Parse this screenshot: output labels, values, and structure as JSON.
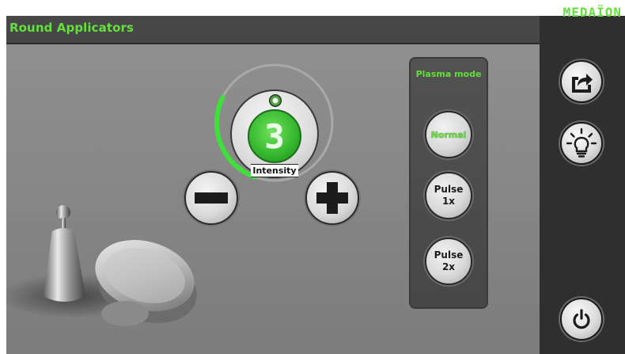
{
  "header": {
    "title": "Round Applicators"
  },
  "brand": {
    "name": "MEDAÏON"
  },
  "intensity": {
    "value": "3",
    "label": "Intensity",
    "level_fraction": 0.3
  },
  "controls": {
    "decrease_icon": "minus-icon",
    "increase_icon": "plus-icon"
  },
  "plasma_mode": {
    "title": "Plasma mode",
    "options": [
      {
        "label": "Normal",
        "active": true
      },
      {
        "label": "Pulse\n1x",
        "active": false
      },
      {
        "label": "Pulse\n2x",
        "active": false
      }
    ]
  },
  "sidebar": {
    "icons": [
      "share-icon",
      "lightbulb-icon",
      "power-icon"
    ]
  },
  "colors": {
    "accent_green": "#63e03a",
    "dial_green": "#2fb12a",
    "panel_dark": "#2f2f2f",
    "content_gray": "#878787"
  }
}
